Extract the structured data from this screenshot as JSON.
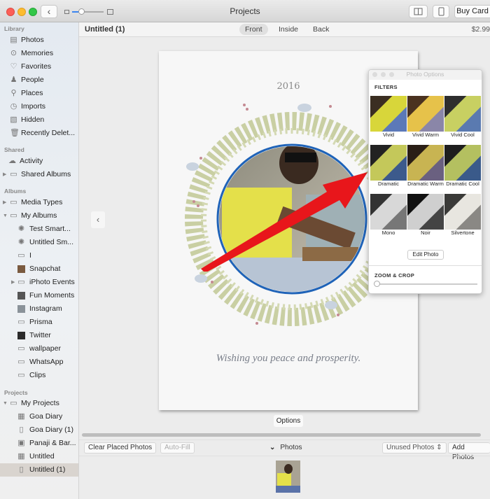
{
  "window": {
    "title": "Projects",
    "back_icon": "‹",
    "buttons": {
      "book_icon": "book-view",
      "phone_icon": "device-view",
      "buy_card": "Buy Card"
    }
  },
  "sidebar": {
    "sections": [
      {
        "title": "Library",
        "items": [
          {
            "label": "Photos",
            "icon": "photos-icon"
          },
          {
            "label": "Memories",
            "icon": "memories-icon"
          },
          {
            "label": "Favorites",
            "icon": "heart-icon"
          },
          {
            "label": "People",
            "icon": "person-icon"
          },
          {
            "label": "Places",
            "icon": "pin-icon"
          },
          {
            "label": "Imports",
            "icon": "clock-icon"
          },
          {
            "label": "Hidden",
            "icon": "hidden-icon"
          },
          {
            "label": "Recently Delet...",
            "icon": "trash-icon"
          }
        ]
      },
      {
        "title": "Shared",
        "items": [
          {
            "label": "Activity",
            "icon": "cloud-icon"
          },
          {
            "label": "Shared Albums",
            "icon": "folder-icon",
            "disclosure": "collapsed"
          }
        ]
      },
      {
        "title": "Albums",
        "items": [
          {
            "label": "Media Types",
            "icon": "folder-icon",
            "disclosure": "collapsed"
          },
          {
            "label": "My Albums",
            "icon": "folder-icon",
            "disclosure": "expanded"
          },
          {
            "label": "Test Smart...",
            "icon": "gear-icon"
          },
          {
            "label": "Untitled Sm...",
            "icon": "gear-icon"
          },
          {
            "label": "I",
            "icon": "album-icon"
          },
          {
            "label": "Snapchat",
            "icon": "album-thumb-icon"
          },
          {
            "label": "iPhoto Events",
            "icon": "folder-icon",
            "disclosure": "collapsed"
          },
          {
            "label": "Fun Moments",
            "icon": "album-thumb-icon"
          },
          {
            "label": "Instagram",
            "icon": "album-thumb-icon"
          },
          {
            "label": "Prisma",
            "icon": "album-icon"
          },
          {
            "label": "Twitter",
            "icon": "album-thumb-icon"
          },
          {
            "label": "wallpaper",
            "icon": "album-icon"
          },
          {
            "label": "WhatsApp",
            "icon": "album-icon"
          },
          {
            "label": "Clips",
            "icon": "album-icon"
          }
        ]
      },
      {
        "title": "Projects",
        "items": [
          {
            "label": "My Projects",
            "icon": "folder-icon",
            "disclosure": "expanded"
          },
          {
            "label": "Goa Diary",
            "icon": "book-icon"
          },
          {
            "label": "Goa Diary (1)",
            "icon": "card-icon"
          },
          {
            "label": "Panaji & Bar...",
            "icon": "calendar-icon"
          },
          {
            "label": "Untitled",
            "icon": "book-icon"
          },
          {
            "label": "Untitled (1)",
            "icon": "card-icon",
            "selected": true
          }
        ]
      }
    ]
  },
  "main": {
    "doc_title": "Untitled (1)",
    "tabs": [
      {
        "label": "Front",
        "active": true
      },
      {
        "label": "Inside",
        "active": false
      },
      {
        "label": "Back",
        "active": false
      }
    ],
    "price": "$2.99",
    "card": {
      "year": "2016",
      "message": "Wishing you peace and prosperity."
    },
    "options_button": "Options",
    "bottom": {
      "clear_placed": "Clear Placed Photos",
      "auto_fill": "Auto-Fill",
      "photos_toggle": "Photos",
      "unused_select": "Unused Photos",
      "add_photos": "Add Photos"
    }
  },
  "photo_options": {
    "title": "Photo Options",
    "filters_heading": "FILTERS",
    "filters": [
      {
        "label": "Vivid"
      },
      {
        "label": "Vivid Warm"
      },
      {
        "label": "Vivid Cool"
      },
      {
        "label": "Dramatic"
      },
      {
        "label": "Dramatic Warm"
      },
      {
        "label": "Dramatic Cool"
      },
      {
        "label": "Mono"
      },
      {
        "label": "Noir"
      },
      {
        "label": "Silvertone"
      }
    ],
    "edit_photo": "Edit Photo",
    "zoom_crop_heading": "ZOOM & CROP",
    "zoom_crop_value": 0
  },
  "colors": {
    "accent": "#3b84f0",
    "annotation_arrow": "#e8161b",
    "frame_ring": "#1f63b8"
  }
}
